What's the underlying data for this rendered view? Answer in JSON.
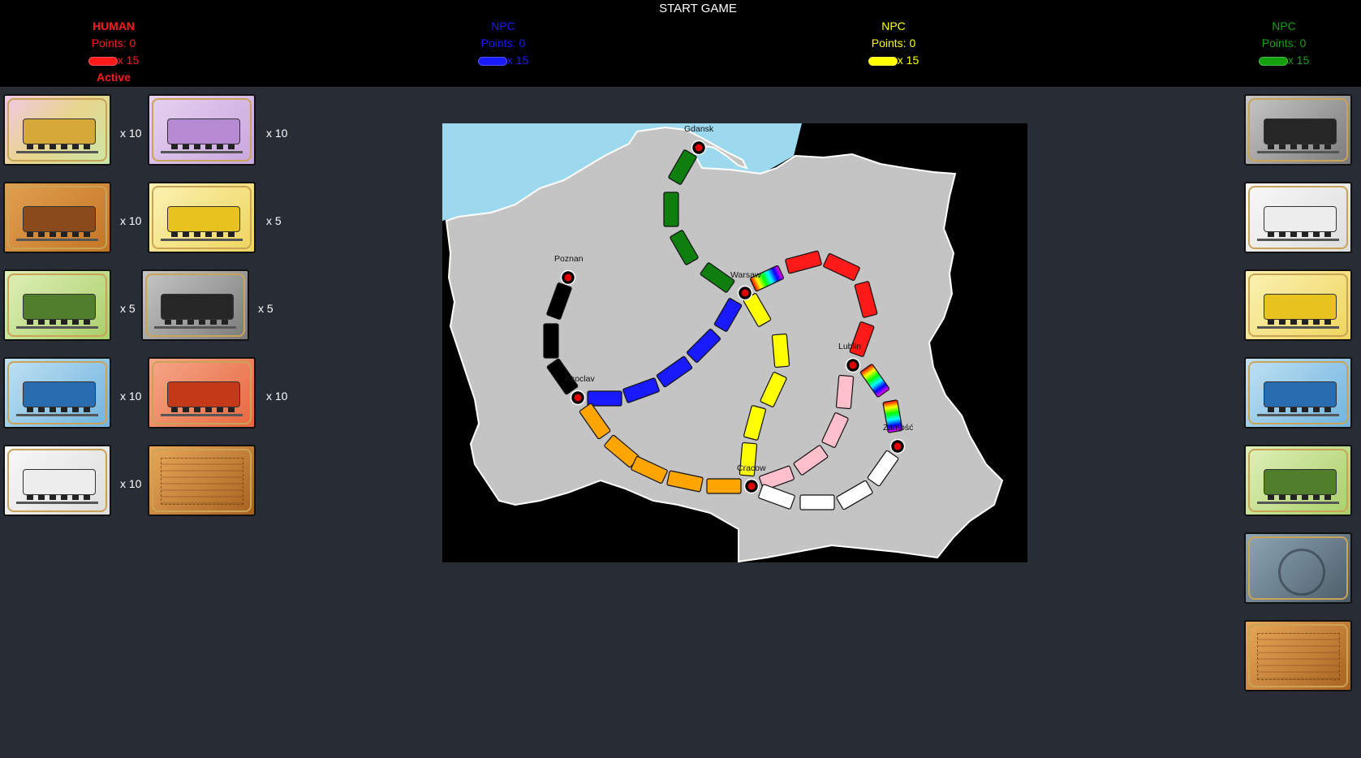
{
  "title": "START GAME",
  "players": [
    {
      "name": "HUMAN",
      "points": "Points: 0",
      "trains": "x 15",
      "status": "Active",
      "color": "#ff1a1a"
    },
    {
      "name": "NPC",
      "points": "Points: 0",
      "trains": "x 15",
      "status": "",
      "color": "#1a1aff"
    },
    {
      "name": "NPC",
      "points": "Points: 0",
      "trains": "x 15",
      "status": "",
      "color": "#ffff00"
    },
    {
      "name": "NPC",
      "points": "Points: 0",
      "trains": "x 15",
      "status": "",
      "color": "#13a10e"
    }
  ],
  "hand": [
    {
      "card": "locomotive",
      "count": "x 10"
    },
    {
      "card": "purple",
      "count": "x 10"
    },
    {
      "card": "orange",
      "count": "x 10"
    },
    {
      "card": "yellow",
      "count": "x 5"
    },
    {
      "card": "green",
      "count": "x 5"
    },
    {
      "card": "black",
      "count": "x 5"
    },
    {
      "card": "blue",
      "count": "x 10"
    },
    {
      "card": "red",
      "count": "x 10"
    },
    {
      "card": "white",
      "count": "x 10"
    },
    {
      "card": "ticket",
      "count": ""
    }
  ],
  "market": [
    "black",
    "white",
    "yellow",
    "blue",
    "green",
    "deck-back",
    "ticket"
  ],
  "cities": [
    "Gdansk",
    "Poznan",
    "Warsaw",
    "Lublin",
    "Wroclav",
    "Zamość",
    "Cracow"
  ],
  "colors": {
    "red": "#ff1a1a",
    "blue": "#1a1aff",
    "yellow": "#ffff00",
    "green": "#0e7f0e",
    "black": "#000000",
    "orange": "#ffa500",
    "pink": "#ffc0cb",
    "white": "#ffffff",
    "sea": "#9dd9ee",
    "land": "#c4c4c4"
  }
}
